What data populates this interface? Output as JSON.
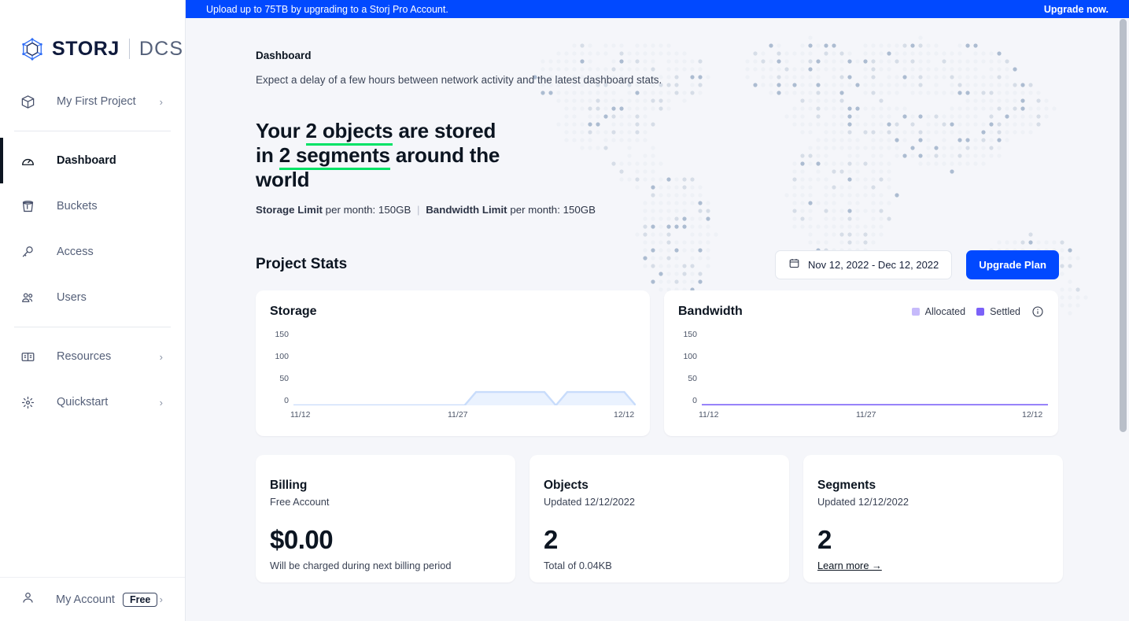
{
  "banner": {
    "message": "Upload up to 75TB by upgrading to a Storj Pro Account.",
    "action": "Upgrade now.",
    "bg": "#0149ff"
  },
  "sidebar": {
    "logo": {
      "brand": "STORJ",
      "product": "DCS"
    },
    "project": {
      "label": "My First Project",
      "icon": "cube-icon",
      "chevron": "›"
    },
    "items": [
      {
        "label": "Dashboard",
        "icon": "gauge-icon",
        "active": true
      },
      {
        "label": "Buckets",
        "icon": "bucket-icon",
        "active": false
      },
      {
        "label": "Access",
        "icon": "key-icon",
        "active": false
      },
      {
        "label": "Users",
        "icon": "users-icon",
        "active": false
      }
    ],
    "items2": [
      {
        "label": "Resources",
        "icon": "book-icon",
        "chevron": "›"
      },
      {
        "label": "Quickstart",
        "icon": "sparkle-icon",
        "chevron": "›"
      }
    ],
    "account": {
      "label": "My Account",
      "badge": "Free",
      "icon": "person-icon",
      "chevron": "›"
    }
  },
  "page": {
    "title": "Dashboard",
    "subtitle": "Expect a delay of a few hours between network activity and the latest dashboard stats.",
    "hero": {
      "lead": "Your",
      "objects": "2 objects",
      "mid": "are stored in",
      "segments": "2 segments",
      "tail": "around the world",
      "underline_color": "#00e366"
    },
    "limits": {
      "storage_label": "Storage Limit",
      "storage_value": "per month: 150GB",
      "divider": "|",
      "bandwidth_label": "Bandwidth Limit",
      "bandwidth_value": "per month: 150GB"
    }
  },
  "stats": {
    "title": "Project Stats",
    "date_range": "Nov 12, 2022 - Dec 12, 2022",
    "calendar_icon": "calendar-icon",
    "upgrade_button": "Upgrade Plan",
    "accent": "#0149ff"
  },
  "chart_data": [
    {
      "type": "area",
      "title": "Storage",
      "xlabel": "",
      "ylabel": "",
      "ylim": [
        0,
        160
      ],
      "yticks": [
        150,
        100,
        50,
        0
      ],
      "xticks": [
        "11/12",
        "11/27",
        "12/12"
      ],
      "grid": false,
      "legend": [],
      "color": "#c8dcfb",
      "fill": "#eaf2fe",
      "x": [
        "11/12",
        "11/13",
        "11/14",
        "11/15",
        "11/16",
        "11/17",
        "11/18",
        "11/19",
        "11/20",
        "11/21",
        "11/22",
        "11/23",
        "11/24",
        "11/25",
        "11/26",
        "11/27",
        "11/28",
        "11/29",
        "11/30",
        "12/01",
        "12/02",
        "12/03",
        "12/04",
        "12/05",
        "12/06",
        "12/07",
        "12/08",
        "12/09",
        "12/10",
        "12/11",
        "12/12"
      ],
      "values": [
        0,
        0,
        0,
        0,
        0,
        0,
        0,
        0,
        0,
        0,
        0,
        0,
        0,
        0,
        0,
        0,
        30,
        30,
        30,
        30,
        30,
        30,
        30,
        0,
        30,
        30,
        30,
        30,
        30,
        30,
        0
      ]
    },
    {
      "type": "line",
      "title": "Bandwidth",
      "xlabel": "",
      "ylabel": "",
      "ylim": [
        0,
        160
      ],
      "yticks": [
        150,
        100,
        50,
        0
      ],
      "xticks": [
        "11/12",
        "11/27",
        "12/12"
      ],
      "grid": false,
      "legend": [
        {
          "name": "Allocated",
          "color": "#c6bafb"
        },
        {
          "name": "Settled",
          "color": "#7b61f8"
        }
      ],
      "info_icon": "info-icon",
      "series": [
        {
          "name": "Allocated",
          "values": [
            0,
            0,
            0,
            0,
            0,
            0,
            0,
            0,
            0,
            0,
            0,
            0,
            0,
            0,
            0,
            0,
            0,
            0,
            0,
            0,
            0,
            0,
            0,
            0,
            0,
            0,
            0,
            0,
            0,
            0,
            0
          ]
        },
        {
          "name": "Settled",
          "values": [
            0,
            0,
            0,
            0,
            0,
            0,
            0,
            0,
            0,
            0,
            0,
            0,
            0,
            0,
            0,
            0,
            0,
            0,
            0,
            0,
            0,
            0,
            0,
            0,
            0,
            0,
            0,
            0,
            0,
            0,
            0
          ]
        }
      ]
    }
  ],
  "cards": [
    {
      "title": "Billing",
      "subtitle": "Free Account",
      "value": "$0.00",
      "footer": "Will be charged during next billing period",
      "link": null
    },
    {
      "title": "Objects",
      "subtitle": "Updated 12/12/2022",
      "value": "2",
      "footer": "Total of 0.04KB",
      "link": null
    },
    {
      "title": "Segments",
      "subtitle": "Updated 12/12/2022",
      "value": "2",
      "footer": null,
      "link": "Learn more →"
    }
  ]
}
